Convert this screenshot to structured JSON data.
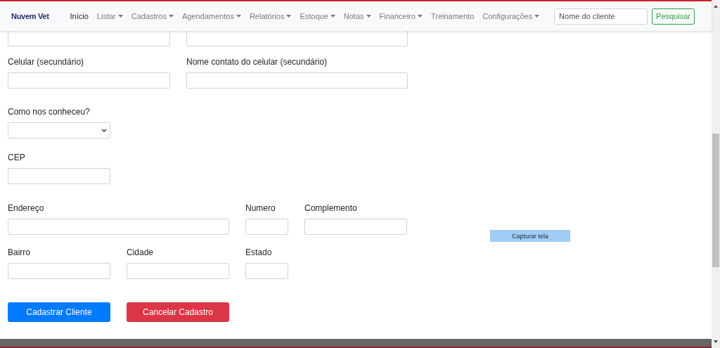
{
  "navbar": {
    "brand": "Nuvem Vet",
    "items": [
      {
        "label": "Início",
        "dropdown": false,
        "selected": true
      },
      {
        "label": "Listar",
        "dropdown": true,
        "selected": false
      },
      {
        "label": "Cadastros",
        "dropdown": true,
        "selected": false
      },
      {
        "label": "Agendamentos",
        "dropdown": true,
        "selected": false
      },
      {
        "label": "Relatórios",
        "dropdown": true,
        "selected": false
      },
      {
        "label": "Estoque",
        "dropdown": true,
        "selected": false
      },
      {
        "label": "Notas",
        "dropdown": true,
        "selected": false
      },
      {
        "label": "Financeiro",
        "dropdown": true,
        "selected": false
      },
      {
        "label": "Treinamento",
        "dropdown": false,
        "selected": false
      },
      {
        "label": "Configurações",
        "dropdown": true,
        "selected": false
      }
    ],
    "search": {
      "placeholder": "Nome do cliente",
      "button": "Pesquisar"
    }
  },
  "form": {
    "fields": [
      {
        "kind": "input"
      },
      {
        "kind": "input"
      },
      {
        "label": "Celular (secundário)",
        "kind": "input"
      },
      {
        "label": "Nome contato do celular (secundário)",
        "kind": "input"
      },
      {
        "label": "Como nos conheceu?",
        "kind": "select"
      },
      {
        "label": "CEP",
        "kind": "input"
      },
      {
        "label": "Endereço",
        "kind": "input"
      },
      {
        "label": "Numero",
        "kind": "input"
      },
      {
        "label": "Complemento",
        "kind": "input"
      },
      {
        "label": "Bairro",
        "kind": "input"
      },
      {
        "label": "Cidade",
        "kind": "input"
      },
      {
        "label": "Estado",
        "kind": "input"
      }
    ],
    "buttons": [
      {
        "label": "Cadastrar Cliente",
        "kind": "primary"
      },
      {
        "label": "Cancelar Cadastro",
        "kind": "danger"
      }
    ]
  },
  "capture_button": "Capturar tela"
}
